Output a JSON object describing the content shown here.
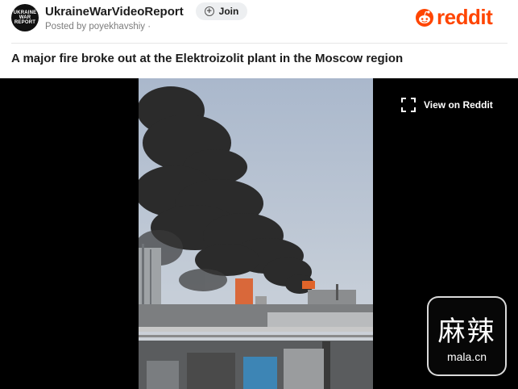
{
  "header": {
    "avatar_text": [
      "UKRAINE",
      "WAR REPORT"
    ],
    "community_name": "UkraineWarVideoReport",
    "posted_by": "Posted by poyekhavshiy ·",
    "join_label": "Join",
    "logo_text": "reddit",
    "brand_color": "#ff4500"
  },
  "post": {
    "title": "A major fire broke out at the Elektroizolit plant in the Moscow region"
  },
  "player": {
    "view_on_reddit_label": "View on Reddit",
    "expand_icon": "expand-icon"
  },
  "watermark": {
    "han": "麻辣",
    "latin": "mala.cn"
  }
}
